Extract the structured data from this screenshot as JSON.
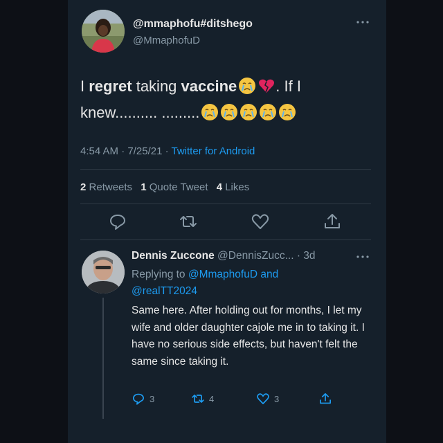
{
  "tweet": {
    "display_name": "@mmaphofu#ditshego",
    "handle": "@MmaphofuD",
    "text_parts": {
      "p1": "I ",
      "p2": "regret",
      "p3": " taking ",
      "p4": "vaccine",
      "p5": ". If I",
      "p6": "knew.......... ........."
    },
    "time": "4:54 AM",
    "date": "7/25/21",
    "client": "Twitter for Android",
    "stats": {
      "retweets_count": "2",
      "retweets_label": "Retweets",
      "quote_count": "1",
      "quote_label": "Quote Tweet",
      "likes_count": "4",
      "likes_label": "Likes"
    }
  },
  "reply": {
    "display_name": "Dennis Zuccone",
    "handle": "@DennisZucc...",
    "age": "· 3d",
    "replying_prefix": "Replying to",
    "mention1": "@MmaphofuD",
    "and_word": "and",
    "mention2": "@realTT2024",
    "text": "Same here. After holding out for months, I let my wife and older daughter cajole me in to taking it. I have no serious side effects, but haven't felt the same since taking it.",
    "reply_count": "3",
    "retweet_count": "4",
    "like_count": "3"
  },
  "icons": {
    "emoji": "crying-face-emoji",
    "broken_heart": "broken-heart-emoji",
    "reply": "reply-icon",
    "retweet": "retweet-icon",
    "like": "heart-icon",
    "share": "share-icon",
    "more": "more-icon"
  },
  "colors": {
    "background": "#15202b",
    "link": "#1d9bf0",
    "secondary_text": "#8899a6"
  }
}
